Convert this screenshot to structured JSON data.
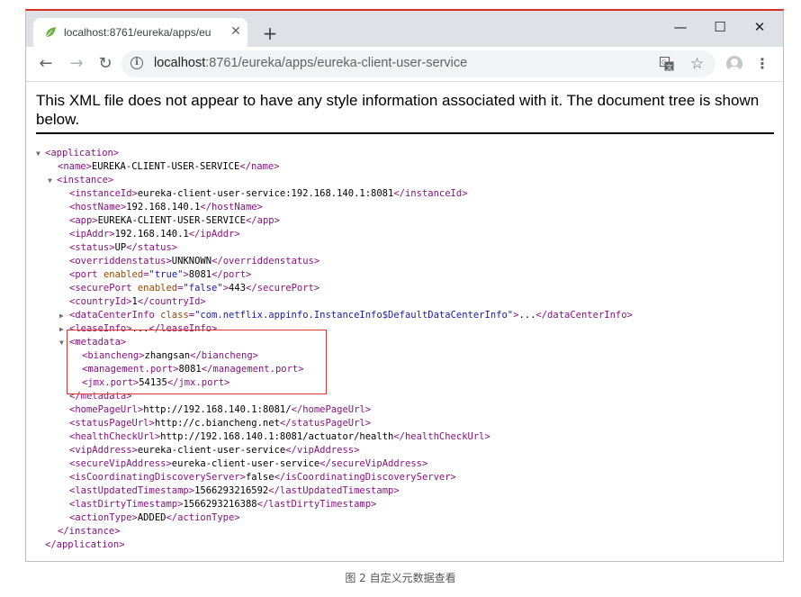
{
  "browser": {
    "tab_title": "localhost:8761/eureka/apps/eu",
    "new_tab_label": "+",
    "window_controls": {
      "minimize": "—",
      "maximize": "☐",
      "close": "✕"
    },
    "tab_close_label": "✕",
    "nav": {
      "back": "←",
      "forward": "→",
      "reload": "↻"
    },
    "url_host": "localhost",
    "url_path": ":8761/eureka/apps/eureka-client-user-service",
    "icons": [
      "leaf-favicon",
      "info-icon",
      "translate-icon",
      "star-icon",
      "profile-icon",
      "more-menu-icon"
    ]
  },
  "notice": "This XML file does not appear to have any style information associated with it. The document tree is shown below.",
  "xml": {
    "root": "application",
    "name": "EUREKA-CLIENT-USER-SERVICE",
    "instance": {
      "instanceId": "eureka-client-user-service:192.168.140.1:8081",
      "hostName": "192.168.140.1",
      "app": "EUREKA-CLIENT-USER-SERVICE",
      "ipAddr": "192.168.140.1",
      "status": "UP",
      "overriddenstatus": "UNKNOWN",
      "port": {
        "enabled": "\"true\"",
        "value": "8081"
      },
      "securePort": {
        "enabled": "\"false\"",
        "value": "443"
      },
      "countryId": "1",
      "dataCenterInfo_class": "\"com.netflix.appinfo.InstanceInfo$DefaultDataCenterInfo\"",
      "collapsed": "...",
      "metadata": {
        "biancheng": "zhangsan",
        "management_port": "8081",
        "jmx_port": "54135"
      },
      "homePageUrl": "http://192.168.140.1:8081/",
      "statusPageUrl": "http://c.biancheng.net",
      "healthCheckUrl": "http://192.168.140.1:8081/actuator/health",
      "vipAddress": "eureka-client-user-service",
      "secureVipAddress": "eureka-client-user-service",
      "isCoordinatingDiscoveryServer": "false",
      "lastUpdatedTimestamp": "1566293216592",
      "lastDirtyTimestamp": "1566293216388",
      "actionType": "ADDED"
    }
  },
  "caption": "图 2  自定义元数据查看",
  "colors": {
    "tag": "#881280",
    "attr_name": "#994500",
    "attr_value": "#1a1aa6",
    "highlight": "#d9392f"
  }
}
